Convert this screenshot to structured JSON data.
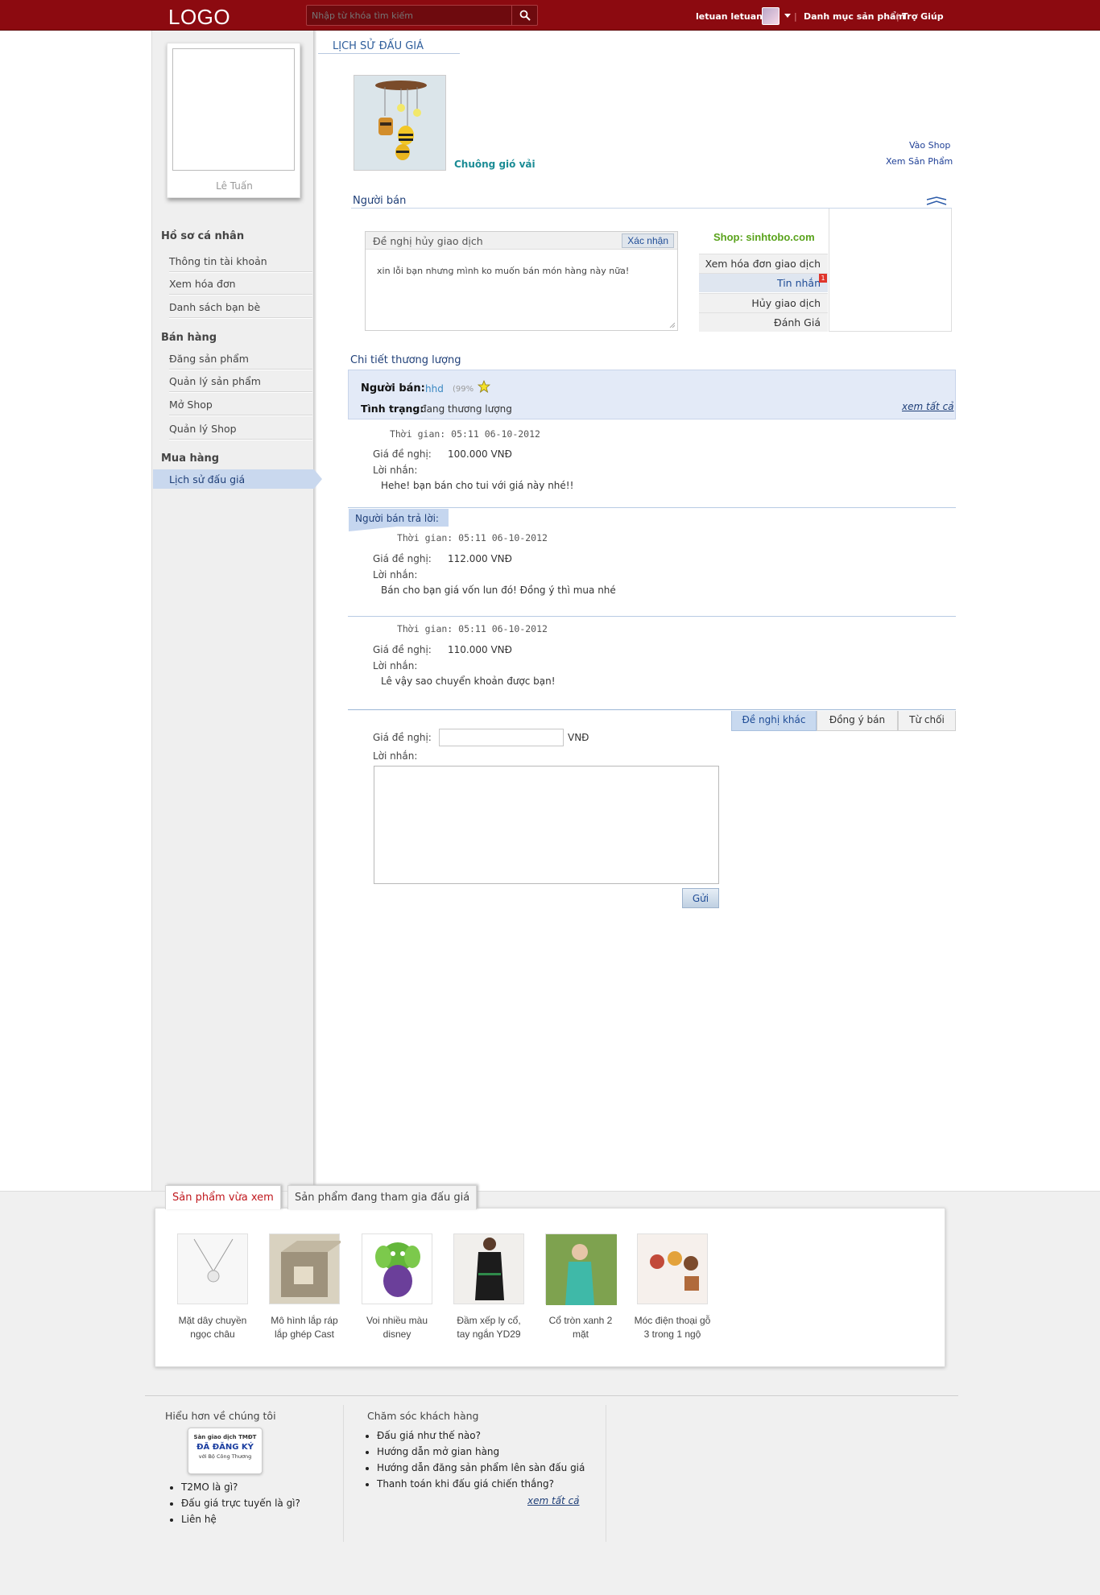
{
  "header": {
    "logo": "LOGO",
    "search_placeholder": "Nhập từ khóa tìm kiếm",
    "user_name": "letuan letuan...",
    "nav_categories": "Danh mục sản phẩm",
    "nav_help": "Trợ Giúp",
    "separator": "|"
  },
  "sidebar": {
    "profile_name": "Lê Tuấn",
    "sections": [
      {
        "title": "Hồ sơ cá nhân",
        "items": [
          "Thông tin tài khoản",
          "Xem hóa đơn",
          "Danh sách bạn bè"
        ]
      },
      {
        "title": "Bán hàng",
        "items": [
          "Đăng sản phẩm",
          "Quản lý sản phẩm",
          "Mở Shop",
          "Quản lý Shop"
        ]
      },
      {
        "title": "Mua hàng",
        "items": [
          "Lịch sử đấu giá"
        ]
      }
    ],
    "active_item": "Lịch sử đấu giá"
  },
  "main": {
    "page_title": "LỊCH SỬ ĐẤU GIÁ",
    "product_name": "Chuông gió vải",
    "link_shop": "Vào Shop",
    "link_product": "Xem Sản Phẩm",
    "seller_heading": "Người bán",
    "cancel_panel": {
      "title": "Đề nghị hủy giao dịch",
      "confirm": "Xác nhận",
      "message": "xin lỗi bạn nhưng mình ko muốn bán món hàng này nữa!"
    },
    "shop_name": "Shop: sinhtobo.com",
    "side_menu": [
      "Xem hóa đơn giao dịch",
      "Tin nhắn",
      "Hủy giao dịch",
      "Đánh Giá"
    ],
    "unread_messages": "1",
    "detail_heading": "Chi tiết thương lượng",
    "seller_label": "Người bán:",
    "seller_name": "hhd",
    "seller_rating": "(99%",
    "status_label": "Tình trạng:",
    "status_value": "đang thương lượng",
    "see_all": "xem tất cả",
    "reply_label": "Người bán trả lời:",
    "offers": [
      {
        "time": "Thời gian: 05:11 06-10-2012",
        "price_label": "Giá đề nghị:",
        "price": "100.000 VNĐ",
        "msg_label": "Lời nhắn:",
        "message": "Hehe! bạn bán cho tui với giá này nhé!!"
      },
      {
        "time": "Thời gian: 05:11 06-10-2012",
        "price_label": "Giá đề nghị:",
        "price": "112.000 VNĐ",
        "msg_label": "Lời nhắn:",
        "message": "Bán cho bạn giá vốn lun đó! Đồng ý thì mua nhé"
      },
      {
        "time": "Thời gian: 05:11 06-10-2012",
        "price_label": "Giá đề nghị:",
        "price": "110.000 VNĐ",
        "msg_label": "Lời nhắn:",
        "message": "Lê vậy sao chuyển khoản được bạn!"
      }
    ],
    "action_tabs": [
      "Đề nghị khác",
      "Đồng ý bán",
      "Từ chối"
    ],
    "form": {
      "price_label": "Giá đề nghị:",
      "currency": "VNĐ",
      "price_value": "",
      "msg_label": "Lời nhắn:",
      "msg_value": "",
      "send": "Gửi"
    }
  },
  "recent": {
    "tab_viewed": "Sản phẩm vừa xem",
    "tab_bidding": "Sản phẩm đang tham gia đấu giá",
    "products": [
      {
        "name_1": "Mặt dây chuyền",
        "name_2": "ngọc châu"
      },
      {
        "name_1": "Mô hình lắp ráp",
        "name_2": "lắp ghép Cast"
      },
      {
        "name_1": "Voi nhiều màu",
        "name_2": "disney"
      },
      {
        "name_1": "Đầm xếp ly cổ,",
        "name_2": "tay ngắn YD29"
      },
      {
        "name_1": "Cổ tròn xanh 2",
        "name_2": "mặt"
      },
      {
        "name_1": "Móc điện thoại gỗ",
        "name_2": "3 trong 1 ngộ"
      }
    ]
  },
  "footer": {
    "about_title": "Hiểu hơn về chúng tôi",
    "badge_line1": "Sàn giao dịch TMĐT",
    "badge_line2": "ĐÃ ĐĂNG KÝ",
    "badge_line3": "với Bộ Công Thương",
    "about_links": [
      "T2MO là gì?",
      "Đấu giá trực tuyến là gì?",
      "Liên hệ"
    ],
    "care_title": "Chăm sóc khách hàng",
    "care_links": [
      "Đấu giá như thế nào?",
      "Hướng dẫn mở gian hàng",
      "Hướng dẫn đăng sản phẩm lên sàn đấu giá",
      "Thanh toán khi đấu giá chiến thắng?"
    ],
    "see_all": "xem tất cả"
  },
  "colors": {
    "header_bg": "#8c0a10",
    "link_blue": "#1f3f78",
    "shop_green": "#5aa31c",
    "active_tab_red": "#c0181e"
  }
}
